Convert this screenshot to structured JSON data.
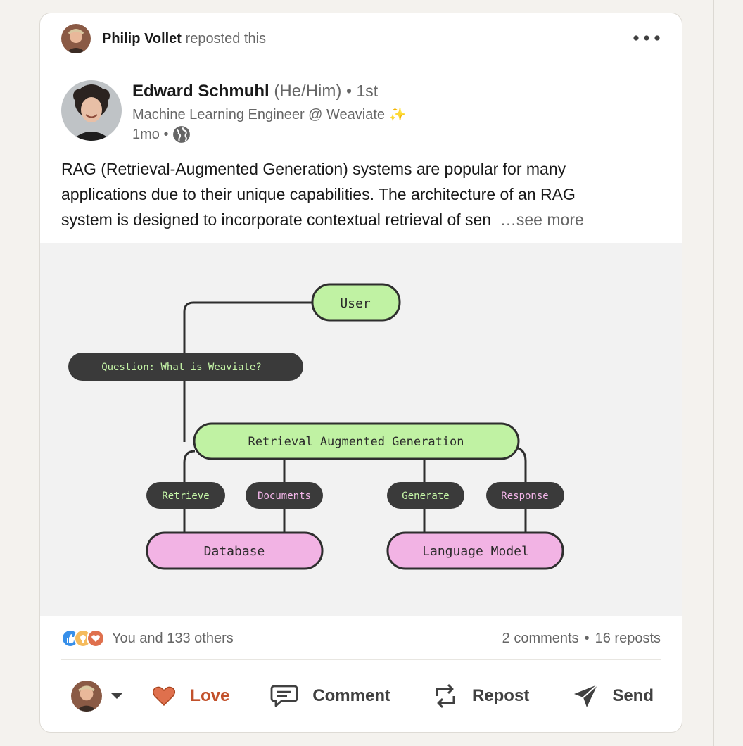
{
  "repost": {
    "name": "Philip Vollet",
    "action": "reposted this",
    "avatar_icon": "profile-photo-philip"
  },
  "author": {
    "name": "Edward Schmuhl",
    "pronouns": "(He/Him)",
    "degree": "• 1st",
    "headline": "Machine Learning Engineer @ Weaviate ✨",
    "time": "1mo •",
    "visibility_icon": "globe-icon"
  },
  "post": {
    "lines": [
      "RAG (Retrieval-Augmented Generation) systems are popular for many",
      "applications due to their unique capabilities. The architecture of an RAG",
      "system is designed to incorporate contextual retrieval of sen"
    ],
    "see_more": "…see more"
  },
  "diagram": {
    "user": "User",
    "question": "Question: What is Weaviate?",
    "rag": "Retrieval Augmented Generation",
    "retrieve": "Retrieve",
    "documents": "Documents",
    "generate": "Generate",
    "response": "Response",
    "database": "Database",
    "language_model": "Language Model",
    "colors": {
      "green": "#c0f2a3",
      "pink": "#f2b3e4",
      "dark": "#3a3a3a",
      "green_text": "#c6f7a8",
      "pink_text": "#f4b6ea"
    }
  },
  "social": {
    "reactions": [
      "like-icon",
      "insightful-icon",
      "love-icon"
    ],
    "count_text": "You and 133 others",
    "comments": "2 comments",
    "separator": "•",
    "reposts": "16 reposts"
  },
  "actions": {
    "love": "Love",
    "comment": "Comment",
    "repost": "Repost",
    "send": "Send",
    "love_color": "#c2512b"
  }
}
